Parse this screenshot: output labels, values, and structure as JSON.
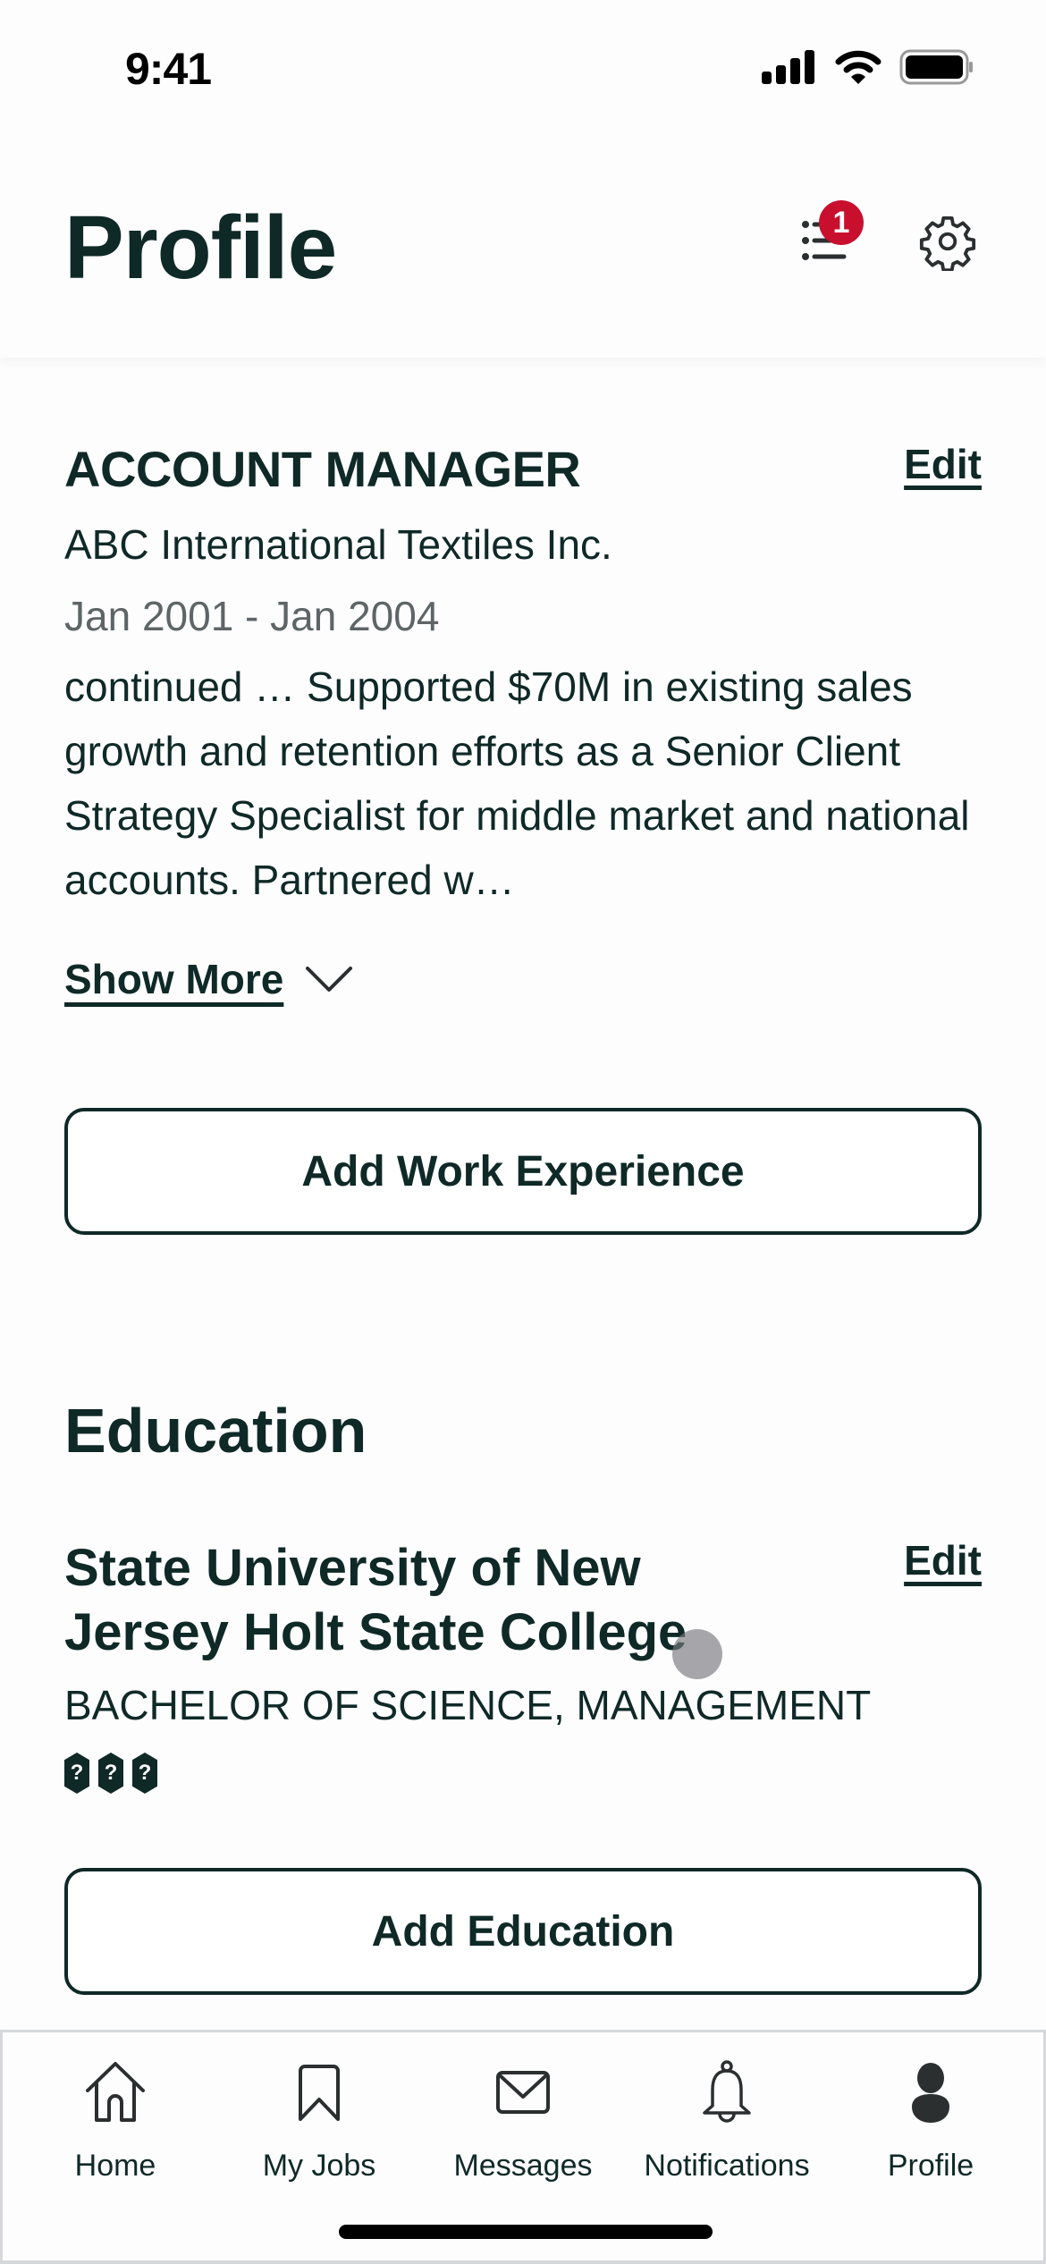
{
  "status_bar": {
    "time": "9:41",
    "icons": [
      "cellular-signal-icon",
      "wifi-icon",
      "battery-icon"
    ]
  },
  "header": {
    "title": "Profile",
    "actions": [
      {
        "name": "checklist-icon",
        "badge": "1"
      },
      {
        "name": "gear-icon"
      }
    ]
  },
  "colors": {
    "text_primary": "#0f2927",
    "text_secondary": "#5e6567",
    "badge": "#c8102e",
    "background": "#fdfdfe"
  },
  "work_experience": {
    "item": {
      "title": "ACCOUNT MANAGER",
      "company": "ABC International Textiles Inc.",
      "dates": "Jan 2001 - Jan 2004",
      "description": "continued … Supported $70M in existing sales growth and retention efforts as a Senior Client Strategy Specialist for middle market  and national accounts. Partnered w…",
      "edit_label": "Edit",
      "show_more_label": "Show More"
    },
    "add_button_label": "Add Work Experience"
  },
  "education": {
    "section_title": "Education",
    "item": {
      "school": "State University of New Jersey Holt State College",
      "degree": "BACHELOR OF SCIENCE, MANAGEMENT",
      "unknown_glyphs": [
        "?",
        "?",
        "?"
      ],
      "edit_label": "Edit"
    },
    "add_button_label": "Add Education"
  },
  "tab_bar": {
    "tabs": [
      {
        "label": "Home",
        "icon": "home-icon"
      },
      {
        "label": "My Jobs",
        "icon": "bookmark-icon"
      },
      {
        "label": "Messages",
        "icon": "envelope-icon"
      },
      {
        "label": "Notifications",
        "icon": "bell-icon"
      },
      {
        "label": "Profile",
        "icon": "person-icon",
        "active": true
      }
    ]
  }
}
